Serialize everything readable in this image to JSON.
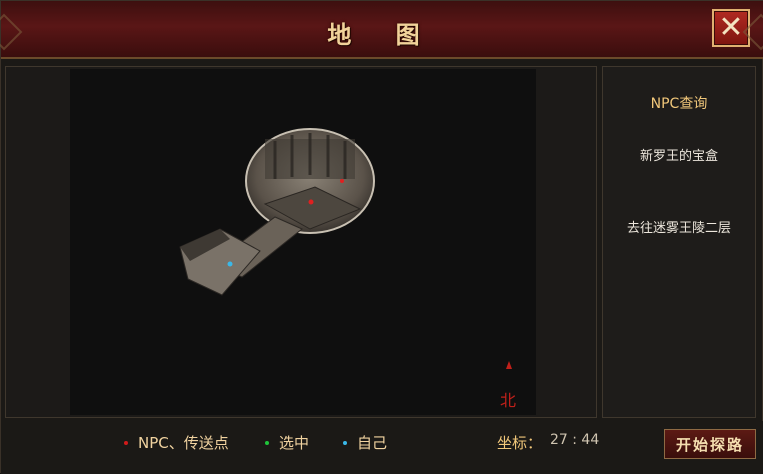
{
  "window": {
    "title": "地 图",
    "close_icon": "close-icon"
  },
  "npc_panel": {
    "title": "NPC查询",
    "items": [
      "新罗王的宝盒",
      "去往迷雾王陵二层"
    ]
  },
  "map": {
    "compass_label": "北",
    "markers": [
      {
        "type": "npc",
        "color": "#e02020"
      },
      {
        "type": "npc",
        "color": "#e02020"
      },
      {
        "type": "self",
        "color": "#3ab8e8"
      }
    ]
  },
  "legend": [
    {
      "label": "NPC、传送点",
      "color": "#d21a1a"
    },
    {
      "label": "选中",
      "color": "#1fc43a"
    },
    {
      "label": "自己",
      "color": "#3ab8e8"
    }
  ],
  "coordinates": {
    "label": "坐标：",
    "value": "27 : 44"
  },
  "route_button": {
    "label": "开始探路"
  }
}
